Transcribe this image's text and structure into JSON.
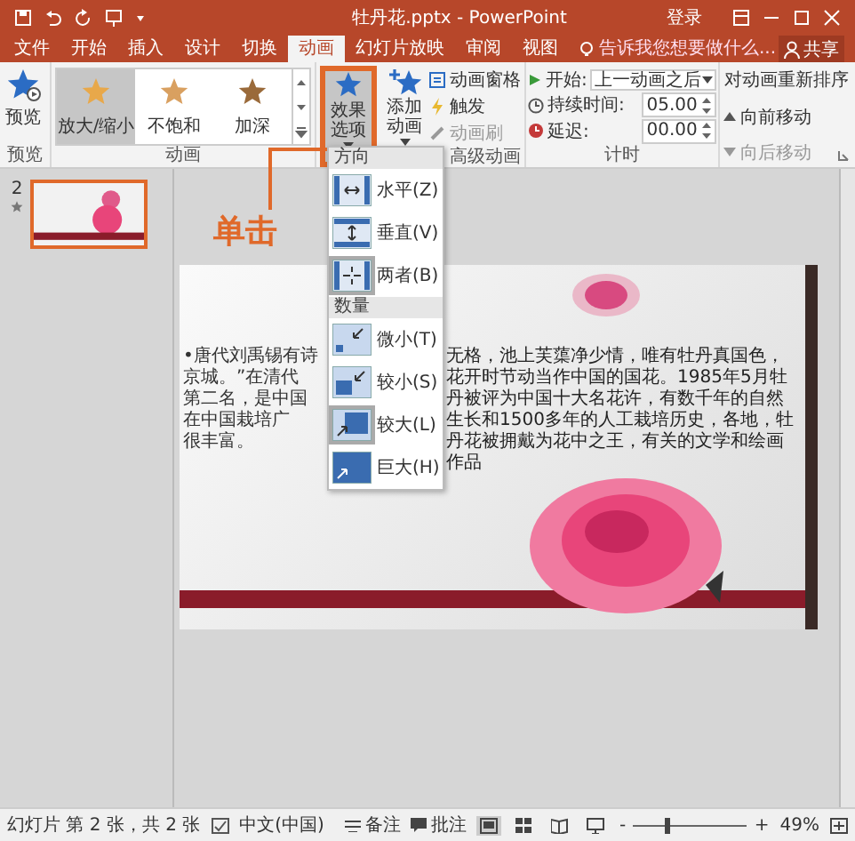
{
  "window": {
    "title": "牡丹花.pptx - PowerPoint",
    "sign_in": "登录"
  },
  "ribbon_tabs": [
    {
      "label": "文件",
      "selected": false
    },
    {
      "label": "开始",
      "selected": false
    },
    {
      "label": "插入",
      "selected": false
    },
    {
      "label": "设计",
      "selected": false
    },
    {
      "label": "切换",
      "selected": false
    },
    {
      "label": "动画",
      "selected": true
    },
    {
      "label": "幻灯片放映",
      "selected": false
    },
    {
      "label": "审阅",
      "selected": false
    },
    {
      "label": "视图",
      "selected": false
    }
  ],
  "tell_me": {
    "placeholder": "告诉我您想要做什么..."
  },
  "share": "共享",
  "ribbon": {
    "preview": {
      "button": "预览",
      "group": "预览"
    },
    "animations": {
      "group": "动画",
      "items": [
        {
          "label": "放大/缩小",
          "selected": true
        },
        {
          "label": "不饱和",
          "selected": false
        },
        {
          "label": "加深",
          "selected": false
        }
      ]
    },
    "effect_options": {
      "label": "效果选项",
      "selected": true
    },
    "add_animation": "添加动画",
    "advanced": {
      "group": "高级动画",
      "items": [
        {
          "label": "动画窗格",
          "disabled": false
        },
        {
          "label": "触发",
          "disabled": false
        },
        {
          "label": "动画刷",
          "disabled": true
        }
      ]
    },
    "timing": {
      "group": "计时",
      "start_label": "开始:",
      "start_value": "上一动画之后",
      "duration_label": "持续时间:",
      "duration": "05.00",
      "delay_label": "延迟:",
      "delay": "00.00"
    },
    "reorder": {
      "title": "对动画重新排序",
      "items": [
        {
          "label": "向前移动",
          "disabled": false
        },
        {
          "label": "向后移动",
          "disabled": true
        }
      ]
    }
  },
  "callout": "单击",
  "thumbnails": [
    {
      "number": "2",
      "selected": true
    }
  ],
  "slide": {
    "bullet": "•",
    "left_lines": [
      "唐代刘禹锡有诗",
      "京城。”在清代",
      "第二名，是中国",
      "在中国栽培广",
      "很丰富。"
    ],
    "right_text": "无格，池上芙蕖净少情，唯有牡丹真国色，花开时节动当作中国的国花。1985年5月牡丹被评为中国十大名花许，有数千年的自然生长和1500多年的人工栽培历史，各地，牡丹花被拥戴为花中之王，有关的文学和绘画作品"
  },
  "dropdown": {
    "sections": [
      {
        "header": "方向",
        "items": [
          {
            "label": "水平(Z)",
            "kind": "horizontal",
            "selected": false
          },
          {
            "label": "垂直(V)",
            "kind": "vertical",
            "selected": false
          },
          {
            "label": "两者(B)",
            "kind": "both",
            "selected": true
          }
        ]
      },
      {
        "header": "数量",
        "items": [
          {
            "label": "微小(T)",
            "kind": "tiny",
            "selected": false
          },
          {
            "label": "较小(S)",
            "kind": "small",
            "selected": false
          },
          {
            "label": "较大(L)",
            "kind": "large",
            "selected": true
          },
          {
            "label": "巨大(H)",
            "kind": "huge",
            "selected": false
          }
        ]
      }
    ]
  },
  "status_bar": {
    "slide_info": "幻灯片 第 2 张，共 2 张",
    "language": "中文(中国)",
    "notes": "备注",
    "comments": "批注",
    "zoom_out": "-",
    "zoom_in": "+",
    "zoom": {
      "level": 0.3
    },
    "zoom_percent": "49%"
  }
}
